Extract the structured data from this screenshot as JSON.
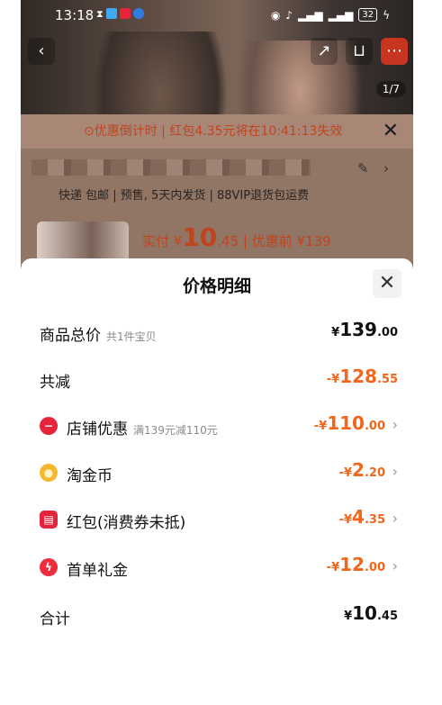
{
  "status": {
    "time": "13:18",
    "battery": "32"
  },
  "background": {
    "pager": "1/7",
    "banner": "⊙优惠倒计时 | 红包4.35元将在10:41:13失效",
    "shipping": "快递 包邮 | 预售, 5天内发货 | 88VIP退货包运费",
    "price_label": "实付 ¥",
    "price_int": "10",
    "price_dec": ".45",
    "price_before": " | 优惠前 ¥139"
  },
  "sheet": {
    "title": "价格明细",
    "rows": [
      {
        "label": "商品总价",
        "sub": "共1件宝贝",
        "cur": "¥",
        "int": "139",
        "dec": ".00"
      },
      {
        "label": "共减",
        "cur": "-¥",
        "int": "128",
        "dec": ".55"
      },
      {
        "label": "店铺优惠",
        "sub": "满139元减110元",
        "cur": "-¥",
        "int": "110",
        "dec": ".00",
        "icon": "store-coupon-icon",
        "icon_color": "#e5243b"
      },
      {
        "label": "淘金币",
        "cur": "-¥",
        "int": "2",
        "dec": ".20",
        "icon": "gold-coin-icon",
        "icon_color": "#f5b82e"
      },
      {
        "label": "红包(消费券未抵)",
        "cur": "-¥",
        "int": "4",
        "dec": ".35",
        "icon": "red-packet-icon",
        "icon_color": "#e5243b"
      },
      {
        "label": "首单礼金",
        "cur": "-¥",
        "int": "12",
        "dec": ".00",
        "icon": "lightning-icon",
        "icon_color": "#ef2b3c"
      },
      {
        "label": "合计",
        "cur": "¥",
        "int": "10",
        "dec": ".45"
      }
    ]
  },
  "colors": {
    "discount": "#f2661a",
    "accent_red": "#e5243b"
  }
}
